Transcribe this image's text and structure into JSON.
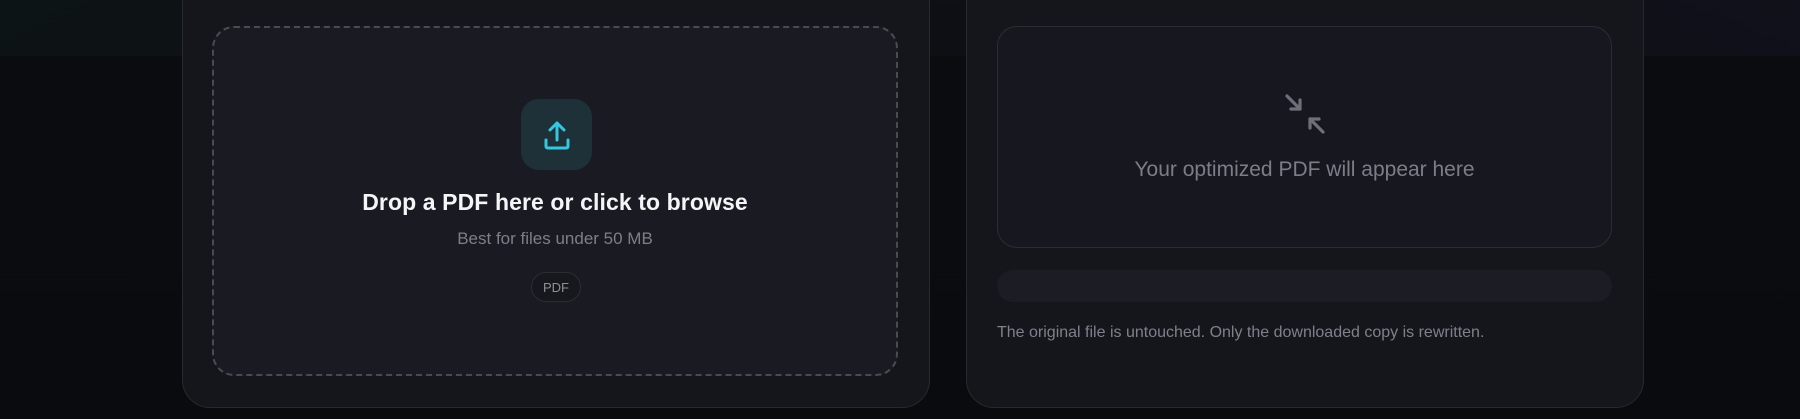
{
  "upload": {
    "title": "Drop a PDF here or click to browse",
    "subtitle": "Best for files under 50 MB",
    "format_chip": "PDF",
    "icon": "upload-icon",
    "accent_color": "#35c6e0"
  },
  "result": {
    "placeholder": "Your optimized PDF will appear here",
    "icon": "shrink-arrows-icon",
    "progress": 0,
    "note": "The original file is untouched. Only the downloaded copy is rewritten."
  }
}
